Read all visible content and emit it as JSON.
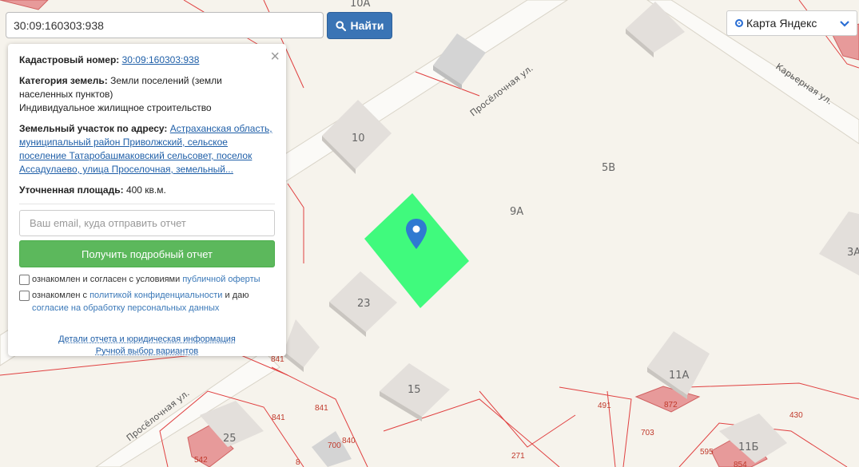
{
  "search": {
    "value": "30:09:160303:938",
    "button_label": "Найти"
  },
  "layer_select": {
    "selected": "Карта Яндекс"
  },
  "info": {
    "cadastral_label": "Кадастровый номер:",
    "cadastral_value": "30:09:160303:938",
    "category_label": "Категория земель:",
    "category_value": "Земли поселений (земли населенных пунктов)",
    "usage_value": "Индивидуальное жилищное строительство",
    "address_label": "Земельный участок по адресу:",
    "address_value": "Астраханская область, муниципальный район Приволжский, сельское поселение Татаробашмаковский сельсовет, поселок Ассадулаево, улица Проселочная, земельный...",
    "area_label": "Уточненная площадь:",
    "area_value": "400 кв.м.",
    "email_placeholder": "Ваш email, куда отправить отчет",
    "report_button": "Получить подробный отчет",
    "consent1_text": "ознакомлен и согласен с условиями",
    "consent1_link": "публичной оферты",
    "consent2_text": "ознакомлен с",
    "consent2_link": "политикой конфиденциальности",
    "consent2_tail": "и даю",
    "consent2_link2": "согласие на обработку персональных данных",
    "details_link": "Детали отчета и юридическая информация",
    "manual_link": "Ручной выбор вариантов"
  },
  "map": {
    "house_labels": [
      "10А",
      "10",
      "5В",
      "9А",
      "23",
      "15",
      "11А",
      "3А",
      "25",
      "11Б"
    ],
    "street_labels": [
      "Просёлочная ул.",
      "Карьерная ул.",
      "Просёлочная ул."
    ],
    "parcel_numbers": [
      "841",
      "841",
      "841",
      "700",
      "840",
      "271",
      "491",
      "872",
      "703",
      "430",
      "595",
      "854",
      "542",
      "8"
    ],
    "colors": {
      "selected_parcel": "#40fa7d",
      "parcel_border": "#e04040",
      "marker": "#2f7ad1"
    }
  }
}
